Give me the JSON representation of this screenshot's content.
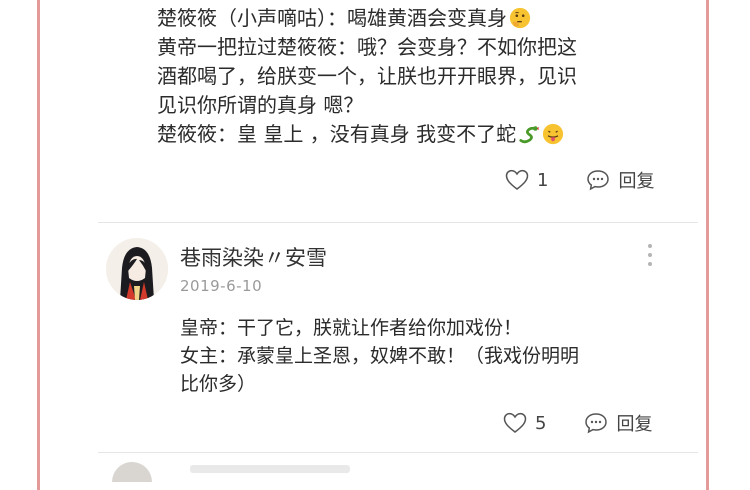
{
  "top_comment": {
    "lines": [
      "楚筱筱（小声嘀咕）：喝雄黄酒会变真身",
      "黄帝一把拉过楚筱筱：哦？会变身？不如你把这",
      "酒都喝了，给朕变一个，让朕也开开眼界，见识",
      "见识你所谓的真身 嗯？",
      "楚筱筱：皇 皇上 ，没有真身 我变不了蛇"
    ],
    "emojis": [
      "thinking-face-icon",
      "snake-icon",
      "tongue-face-icon"
    ],
    "like_count": "1",
    "reply_label": "回复"
  },
  "comment": {
    "username": "巷雨染染〃安雪",
    "date": "2019-6-10",
    "lines": [
      "皇帝：干了它，朕就让作者给你加戏份！",
      "女主：承蒙皇上圣恩，奴婢不敢！（我戏份明明",
      "比你多）"
    ],
    "like_count": "5",
    "reply_label": "回复"
  },
  "colors": {
    "frame_border": "#e59a9a",
    "text": "#2b2b2b",
    "muted": "#9a9a9a",
    "snake_green": "#4a9a2a",
    "emoji_yellow": "#f7c331"
  }
}
